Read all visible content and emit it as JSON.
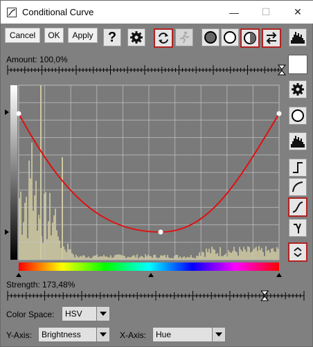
{
  "window": {
    "title": "Conditional Curve",
    "minimize_glyph": "—",
    "maximize_glyph": "☐",
    "close_glyph": "✕"
  },
  "toolbar": {
    "cancel_label": "Cancel",
    "ok_label": "OK",
    "apply_label": "Apply",
    "help_glyph": "?"
  },
  "amount": {
    "label": "Amount: 100,0%",
    "value_percent": 100.0
  },
  "strength": {
    "label": "Strength: 173,48%",
    "value_percent": 173.48
  },
  "color_space": {
    "label": "Color Space:",
    "value": "HSV"
  },
  "y_axis": {
    "label": "Y-Axis:",
    "value": "Brightness"
  },
  "x_axis": {
    "label": "X-Axis:",
    "value": "Hue"
  },
  "icons": [
    "help-icon",
    "gear-icon",
    "refresh-icon",
    "run-icon",
    "circle-dark-icon",
    "circle-white-icon",
    "circle-half-icon",
    "swap-icon",
    "histogram-icon",
    "linear-curve-icon",
    "log-curve-icon",
    "s-curve-icon",
    "gamma-icon",
    "expand-icon"
  ],
  "colors": {
    "curve": "#e01010",
    "selected_border": "#b22222",
    "histogram": "#cfc9a0",
    "graph_bg": "#7a7a7a"
  }
}
